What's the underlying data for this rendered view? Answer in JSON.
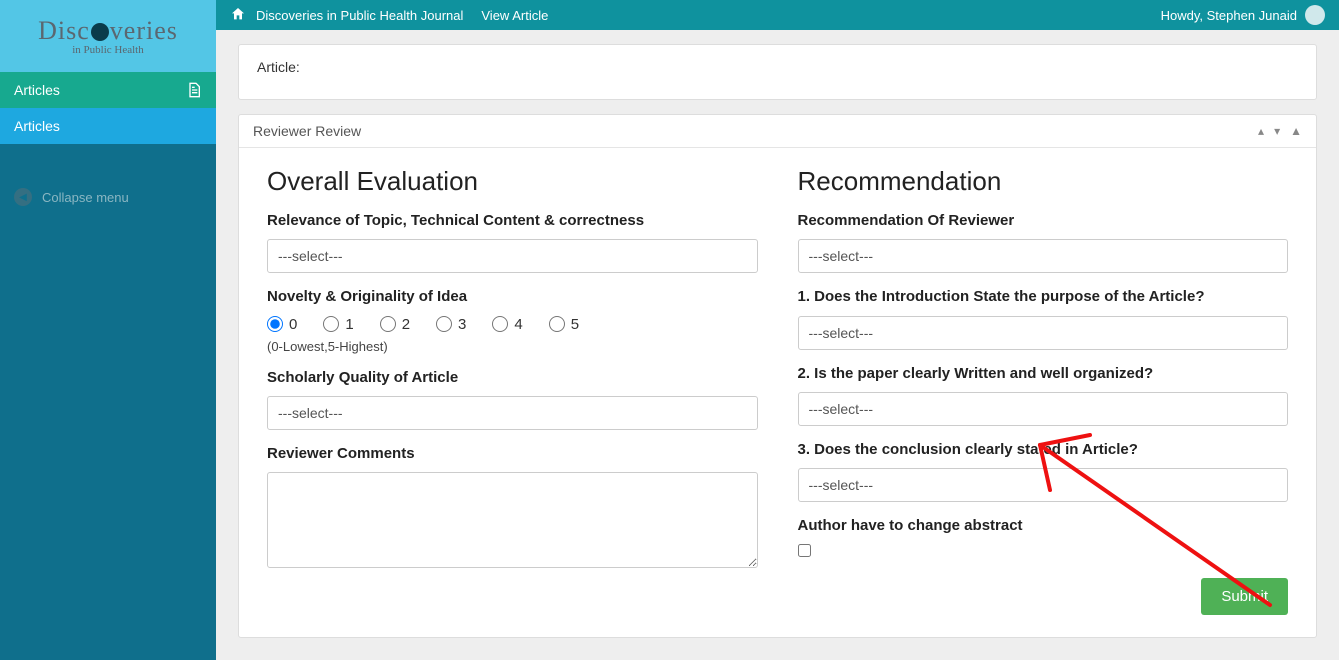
{
  "topbar": {
    "site_title": "Discoveries in Public Health Journal",
    "view_label": "View Article",
    "greeting": "Howdy, Stephen Junaid"
  },
  "logo": {
    "top": "Discoveries",
    "sub": "in Public Health"
  },
  "sidebar": {
    "articles_top": "Articles",
    "articles_sub": "Articles",
    "collapse": "Collapse menu"
  },
  "article_card": {
    "label": "Article:"
  },
  "panel": {
    "title": "Reviewer Review"
  },
  "overall": {
    "heading": "Overall Evaluation",
    "relevance_label": "Relevance of Topic, Technical Content & correctness",
    "relevance_value": "---select---",
    "novelty_label": "Novelty & Originality of Idea",
    "novelty_options": [
      "0",
      "1",
      "2",
      "3",
      "4",
      "5"
    ],
    "novelty_selected": "0",
    "novelty_hint": "(0-Lowest,5-Highest)",
    "scholarly_label": "Scholarly Quality of Article",
    "scholarly_value": "---select---",
    "comments_label": "Reviewer Comments",
    "comments_value": ""
  },
  "recommendation": {
    "heading": "Recommendation",
    "rec_label": "Recommendation Of Reviewer",
    "rec_value": "---select---",
    "q1_label": "1. Does the Introduction State the purpose of the Article?",
    "q1_value": "---select---",
    "q2_label": "2. Is the paper clearly Written and well organized?",
    "q2_value": "---select---",
    "q3_label": "3. Does the conclusion clearly stated in Article?",
    "q3_value": "---select---",
    "abstract_label": "Author have to change abstract",
    "abstract_checked": false,
    "submit_label": "Submit"
  }
}
